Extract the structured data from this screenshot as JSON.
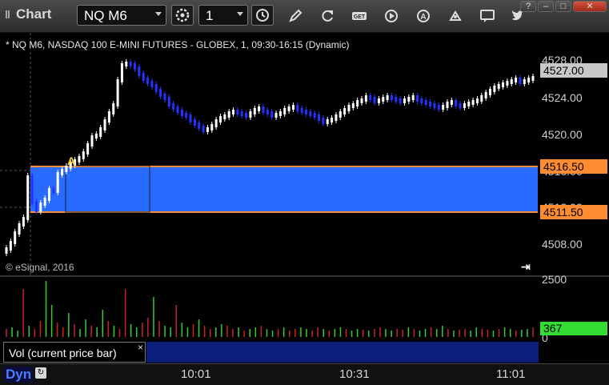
{
  "window": {
    "title": "Chart",
    "controls": [
      "?",
      "–",
      "□",
      "✕"
    ]
  },
  "toolbar": {
    "symbol": "NQ M6",
    "interval": "1",
    "icons": [
      "settings-icon",
      "clock-icon",
      "pencil-icon",
      "refresh-icon",
      "get-icon",
      "play-icon",
      "alert-icon",
      "drawing-icon",
      "chat-icon",
      "twitter-icon"
    ],
    "get_label": "GET"
  },
  "chart": {
    "caption": "* NQ M6, NASDAQ 100 E-MINI FUTURES - GLOBEX, 1, 09:30-16:15 (Dynamic)",
    "copyright": "© eSignal, 2016",
    "annotation": "A",
    "price_ticks": [
      "4528.00",
      "4524.00",
      "4520.00",
      "4516.00",
      "4512.00",
      "4508.00"
    ],
    "last_price": "4527.00",
    "range_top": "4516.50",
    "range_bottom": "4511.50",
    "colors": {
      "up": "#ffffff",
      "down": "#2233ff",
      "range_fill": "#2a6bff",
      "range_line": "#ff8c30"
    }
  },
  "volume": {
    "legend": "Vol (current price bar)",
    "close_glyph": "×",
    "max_label": "2500",
    "min_label": "0",
    "current": "367",
    "colors": {
      "up": "#33cc33",
      "down": "#cc2222"
    }
  },
  "time_axis": {
    "mode": "Dyn",
    "labels": [
      "10:01",
      "10:31",
      "11:01"
    ]
  }
}
